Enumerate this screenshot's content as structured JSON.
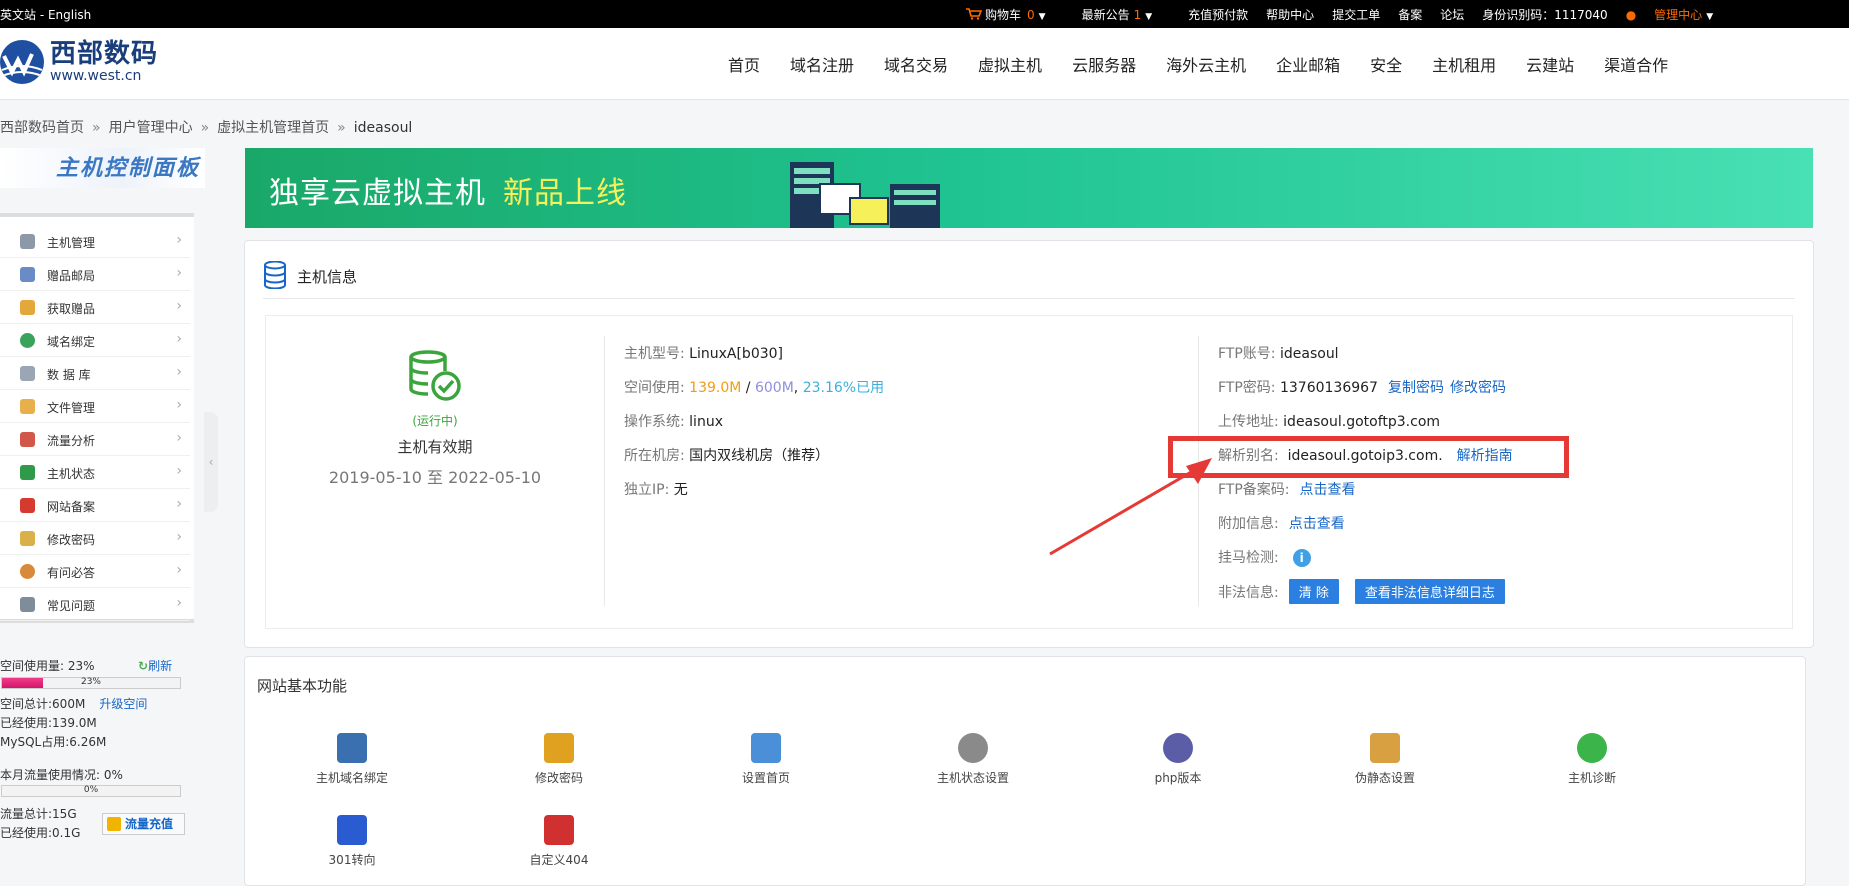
{
  "topbar": {
    "lang": "英文站 - English",
    "cart_label": "购物车",
    "cart_count": "0",
    "notice_label": "最新公告",
    "notice_count": "1",
    "recharge": "充值预付款",
    "help": "帮助中心",
    "ticket": "提交工单",
    "beian": "备案",
    "forum": "论坛",
    "id_code": "身份识别码：1117040",
    "admin": "管理中心"
  },
  "header": {
    "logo_cn": "西部数码",
    "logo_en": "www.west.cn",
    "nav": [
      "首页",
      "域名注册",
      "域名交易",
      "虚拟主机",
      "云服务器",
      "海外云主机",
      "企业邮箱",
      "安全",
      "主机租用",
      "云建站",
      "渠道合作"
    ]
  },
  "breadcrumb": [
    "西部数码首页",
    "用户管理中心",
    "虚拟主机管理首页",
    "ideasoul"
  ],
  "sidebar": {
    "title": "主机控制面板",
    "items": [
      {
        "label": "主机管理",
        "icon": "server-icon"
      },
      {
        "label": "赠品邮局",
        "icon": "mail-icon"
      },
      {
        "label": "获取赠品",
        "icon": "gift-icon"
      },
      {
        "label": "域名绑定",
        "icon": "globe-icon"
      },
      {
        "label": "数 据 库",
        "icon": "database-icon"
      },
      {
        "label": "文件管理",
        "icon": "folder-icon"
      },
      {
        "label": "流量分析",
        "icon": "chart-icon"
      },
      {
        "label": "主机状态",
        "icon": "status-icon"
      },
      {
        "label": "网站备案",
        "icon": "flag-icon"
      },
      {
        "label": "修改密码",
        "icon": "key-icon"
      },
      {
        "label": "有问必答",
        "icon": "user-icon"
      },
      {
        "label": "常见问题",
        "icon": "doc-icon"
      }
    ],
    "stats": {
      "space_usage": "空间使用量: 23%",
      "refresh": "刷新",
      "space_pct_text": "23%",
      "space_fraction": 0.23,
      "space_total": "空间总计:600M",
      "upgrade": "升级空间",
      "space_used": "已经使用:139.0M",
      "mysql": "MySQL占用:6.26M",
      "traffic_usage": "本月流量使用情况: 0%",
      "traffic_pct_text": "0%",
      "traffic_fraction": 0,
      "traffic_total": "流量总计:15G",
      "traffic_used": "已经使用:0.1G",
      "traffic_recharge": "流量充值"
    }
  },
  "banner": {
    "text1": "独享云虚拟主机",
    "text2": "新品上线"
  },
  "host_info": {
    "title": "主机信息",
    "running": "(运行中)",
    "validity_label": "主机有效期",
    "validity_dates": "2019-05-10 至 2022-05-10",
    "model_k": "主机型号:",
    "model_v": "LinuxA[b030]",
    "space_k": "空间使用:",
    "space_used": "139.0M",
    "space_sep": "/",
    "space_total": "600M",
    "space_comma": ",",
    "space_pct": "23.16%已用",
    "os_k": "操作系统:",
    "os_v": "linux",
    "room_k": "所在机房:",
    "room_v": "国内双线机房（推荐）",
    "ip_k": "独立IP:",
    "ip_v": "无",
    "ftp_account_k": "FTP账号:",
    "ftp_account_v": "ideasoul",
    "ftp_pwd_k": "FTP密码:",
    "ftp_pwd_v": "13760136967",
    "copy_pwd": "复制密码",
    "change_pwd": "修改密码",
    "upload_k": "上传地址:",
    "upload_v": "ideasoul.gotoftp3.com",
    "alias_k": "解析别名:",
    "alias_v": "ideasoul.gotoip3.com.",
    "alias_guide": "解析指南",
    "ftp_beian_k": "FTP备案码:",
    "ftp_beian_link": "点击查看",
    "extra_k": "附加信息:",
    "extra_link": "点击查看",
    "trojan_k": "挂马检测:",
    "illegal_k": "非法信息:",
    "clear_btn": "清 除",
    "log_btn": "查看非法信息详细日志"
  },
  "features": {
    "title": "网站基本功能",
    "items": [
      {
        "label": "主机域名绑定",
        "icon": "domain-bind-icon",
        "color": "#3a6fb0"
      },
      {
        "label": "修改密码",
        "icon": "lock-icon",
        "color": "#e0a020"
      },
      {
        "label": "设置首页",
        "icon": "edit-page-icon",
        "color": "#4a8fd8"
      },
      {
        "label": "主机状态设置",
        "icon": "gear-icon",
        "color": "#8a8a8a"
      },
      {
        "label": "php版本",
        "icon": "php-icon",
        "color": "#5b5ea6"
      },
      {
        "label": "伪静态设置",
        "icon": "rewrite-icon",
        "color": "#d8a040"
      },
      {
        "label": "主机诊断",
        "icon": "plus-icon",
        "color": "#3bb44a"
      },
      {
        "label": "301转向",
        "icon": "redirect-icon",
        "color": "#2a5bd0"
      },
      {
        "label": "自定义404",
        "icon": "error-page-icon",
        "color": "#d03030"
      }
    ]
  },
  "colors": {
    "highlight": "#e53935",
    "accent_blue": "#1766c7",
    "running_green": "#3aa53a"
  }
}
